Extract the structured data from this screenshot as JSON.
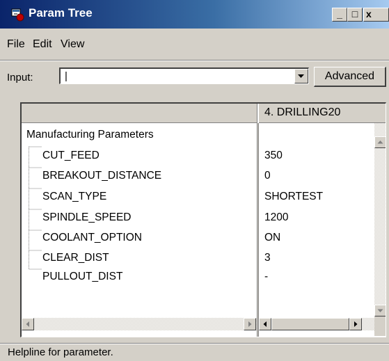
{
  "window": {
    "title": "Param Tree",
    "controls": {
      "minimize": "_",
      "maximize": "□",
      "close": "x"
    }
  },
  "menubar": {
    "items": [
      "File",
      "Edit",
      "View"
    ]
  },
  "toolbar": {
    "input_label": "Input:",
    "input_value": "|",
    "advanced_label": "Advanced"
  },
  "table": {
    "column_header": "4. DRILLING20",
    "root_label": "Manufacturing Parameters",
    "rows": [
      {
        "name": "CUT_FEED",
        "value": "350"
      },
      {
        "name": "BREAKOUT_DISTANCE",
        "value": "0"
      },
      {
        "name": "SCAN_TYPE",
        "value": "SHORTEST"
      },
      {
        "name": "SPINDLE_SPEED",
        "value": "1200"
      },
      {
        "name": "COOLANT_OPTION",
        "value": "ON"
      },
      {
        "name": "CLEAR_DIST",
        "value": "3"
      },
      {
        "name": "PULLOUT_DIST",
        "value": "-"
      }
    ]
  },
  "statusbar": {
    "text": "Helpline for parameter."
  },
  "colors": {
    "title_bar_start": "#0a246a",
    "title_bar_end": "#a6caf0",
    "face": "#d4d0c8"
  }
}
